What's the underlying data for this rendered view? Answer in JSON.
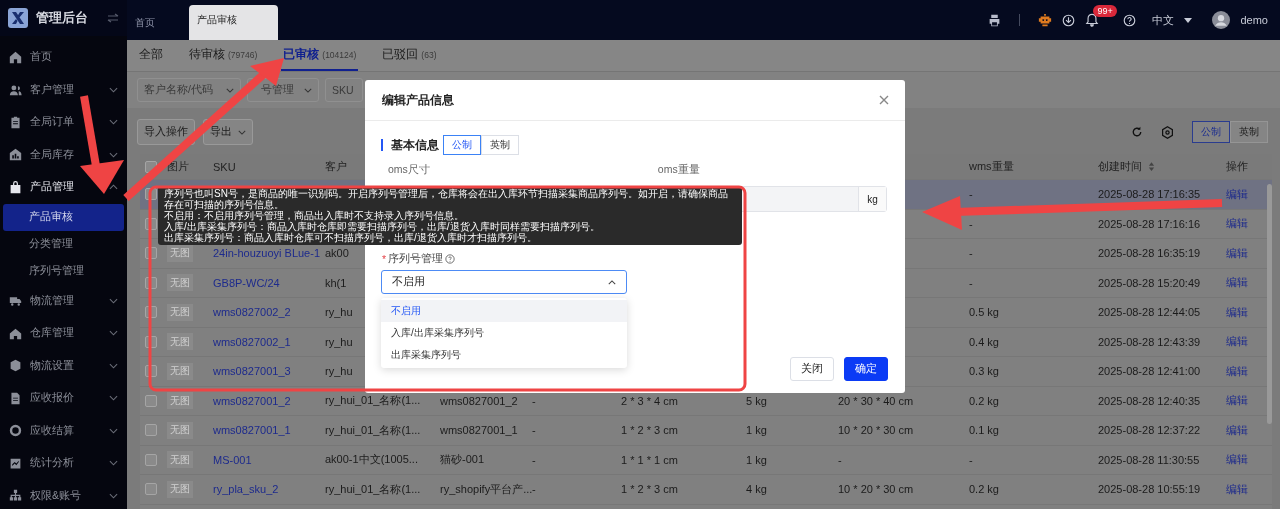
{
  "sidebar": {
    "logo_text": "管理后台",
    "items": [
      {
        "label": "首页",
        "kind": "link",
        "selected": false
      },
      {
        "label": "客户管理",
        "kind": "group",
        "expanded": false,
        "selected": false
      },
      {
        "label": "全局订单",
        "kind": "group",
        "expanded": false,
        "selected": false
      },
      {
        "label": "全局库存",
        "kind": "group",
        "expanded": false,
        "selected": false
      },
      {
        "label": "产品管理",
        "kind": "group",
        "expanded": true,
        "selected": true,
        "children": [
          {
            "label": "产品审核",
            "selected": true
          },
          {
            "label": "分类管理",
            "selected": false
          },
          {
            "label": "序列号管理",
            "selected": false
          }
        ]
      },
      {
        "label": "物流管理",
        "kind": "group",
        "expanded": false,
        "selected": false
      },
      {
        "label": "仓库管理",
        "kind": "group",
        "expanded": false,
        "selected": false
      },
      {
        "label": "物流设置",
        "kind": "group",
        "expanded": false,
        "selected": false
      },
      {
        "label": "应收报价",
        "kind": "group",
        "expanded": false,
        "selected": false
      },
      {
        "label": "应收结算",
        "kind": "group",
        "expanded": false,
        "selected": false
      },
      {
        "label": "统计分析",
        "kind": "group",
        "expanded": false,
        "selected": false
      },
      {
        "label": "权限&账号",
        "kind": "group",
        "expanded": false,
        "selected": false
      }
    ]
  },
  "top_bar": {
    "page_tabs": [
      {
        "label": "首页",
        "selected": false
      },
      {
        "label": "产品审核",
        "selected": true
      }
    ],
    "notification_badge": "99+",
    "language": "中文",
    "user": "demo"
  },
  "status_tabs": [
    {
      "label": "全部",
      "selected": false
    },
    {
      "label": "待审核",
      "count": "(79746)",
      "selected": false
    },
    {
      "label": "已审核",
      "count": "(104124)",
      "selected": true
    },
    {
      "label": "已驳回",
      "count": "(63)",
      "selected": false
    }
  ],
  "filters": [
    {
      "placeholder": "客户名称/代码"
    },
    {
      "placeholder": "号管理"
    },
    {
      "placeholder": "SKU"
    }
  ],
  "toolbar": {
    "buttons": [
      {
        "label": "导入操作",
        "kind": "plain"
      },
      {
        "label": "导出",
        "kind": "menu"
      }
    ],
    "unit_toggle": [
      {
        "label": "公制",
        "selected": true
      },
      {
        "label": "英制",
        "selected": false
      }
    ]
  },
  "table": {
    "header_checked": false,
    "header": {
      "image": "图片",
      "sku": "SKU",
      "customer": "客户",
      "wms_weight": "wms重量",
      "created": "创建时间",
      "action": "操作"
    },
    "rows": [
      {
        "checked": false,
        "highlighted": true,
        "wms_weight": "-",
        "created": "2025-08-28 17:16:35",
        "action": "编辑"
      },
      {
        "checked": false,
        "highlighted": false,
        "wms_weight": "-",
        "created": "2025-08-28 17:16:16",
        "action": "编辑"
      },
      {
        "checked": false,
        "highlighted": false,
        "image": "无图",
        "sku": "24in-houzuoyi BLue-1",
        "customer": "ak00",
        "wms_weight": "-",
        "created": "2025-08-28 16:35:19",
        "action": "编辑"
      },
      {
        "checked": false,
        "highlighted": false,
        "image": "无图",
        "sku": "GB8P-WC/24",
        "customer": "kh(1",
        "wms_weight": "-",
        "created": "2025-08-28 15:20:49",
        "action": "编辑"
      },
      {
        "checked": false,
        "highlighted": false,
        "image": "无图",
        "sku": "wms0827002_2",
        "customer": "ry_hu",
        "wms_weight": "0.5 kg",
        "created": "2025-08-28 12:44:05",
        "action": "编辑"
      },
      {
        "checked": false,
        "highlighted": false,
        "image": "无图",
        "sku": "wms0827002_1",
        "customer": "ry_hu",
        "wms_weight": "0.4 kg",
        "created": "2025-08-28 12:43:39",
        "action": "编辑"
      },
      {
        "checked": false,
        "highlighted": false,
        "image": "无图",
        "sku": "wms0827001_3",
        "customer": "ry_hu",
        "wms_weight": "0.3 kg",
        "created": "2025-08-28 12:41:00",
        "action": "编辑"
      },
      {
        "checked": false,
        "highlighted": false,
        "image": "无图",
        "sku": "wms0827001_2",
        "customer": "ry_hui_01_名称(1...",
        "column_4": "wms0827001_2",
        "column_5": "-",
        "column_6": "2 * 3 * 4 cm",
        "column_7": "5 kg",
        "column_8": "20 * 30 * 40 cm",
        "wms_weight": "0.2 kg",
        "created": "2025-08-28 12:40:35",
        "action": "编辑"
      },
      {
        "checked": false,
        "highlighted": false,
        "image": "无图",
        "sku": "wms0827001_1",
        "customer": "ry_hui_01_名称(1...",
        "column_4": "wms0827001_1",
        "column_5": "-",
        "column_6": "1 * 2 * 3 cm",
        "column_7": "1 kg",
        "column_8": "10 * 20 * 30 cm",
        "wms_weight": "0.1 kg",
        "created": "2025-08-28 12:37:22",
        "action": "编辑"
      },
      {
        "checked": false,
        "highlighted": false,
        "image": "无图",
        "sku": "MS-001",
        "customer": "ak00-1中文(1005...",
        "column_4": "猫砂-001",
        "column_5": "-",
        "column_6": "1 * 1 * 1 cm",
        "column_7": "1 kg",
        "column_8": "-",
        "wms_weight": "-",
        "created": "2025-08-28 11:30:55",
        "action": "编辑"
      },
      {
        "checked": false,
        "highlighted": false,
        "image": "无图",
        "sku": "ry_pla_sku_2",
        "customer": "ry_hui_01_名称(1...",
        "column_4": "ry_shopify平台产...",
        "column_5": "-",
        "column_6": "1 * 2 * 3 cm",
        "column_7": "4 kg",
        "column_8": "10 * 20 * 30 cm",
        "wms_weight": "0.2 kg",
        "created": "2025-08-28 10:55:19",
        "action": "编辑"
      }
    ]
  },
  "modal": {
    "title": "编辑产品信息",
    "section_title": "基本信息",
    "unit_toggle": [
      {
        "label": "公制",
        "selected": true
      },
      {
        "label": "英制",
        "selected": false
      }
    ],
    "size_label": "oms尺寸",
    "weight_label": "oms重量",
    "weight_unit": "kg",
    "serial_label": "序列号管理",
    "serial_required_mark": "*",
    "serial_value": "不启用",
    "serial_expanded": true,
    "serial_options": [
      {
        "label": "不启用",
        "selected": true
      },
      {
        "label": "入库/出库采集序列号",
        "selected": false
      },
      {
        "label": "出库采集序列号",
        "selected": false
      }
    ],
    "tooltip_lines": [
      "序列号也叫SN号，是商品的唯一识别码。开启序列号管理后，仓库将会在出入库环节扫描采集商品序列号。如开启，请确保商品存在可扫描的序列号信息。",
      "不启用：不启用序列号管理，商品出入库时不支持录入序列号信息。",
      "入库/出库采集序列号：商品入库时仓库即需要扫描序列号，出库/退货入库时同样需要扫描序列号。",
      "出库采集序列号：商品入库时仓库可不扫描序列号，出库/退货入库时才扫描序列号。"
    ],
    "buttons": [
      {
        "label": "关闭",
        "kind": "secondary"
      },
      {
        "label": "确定",
        "kind": "primary"
      }
    ]
  }
}
